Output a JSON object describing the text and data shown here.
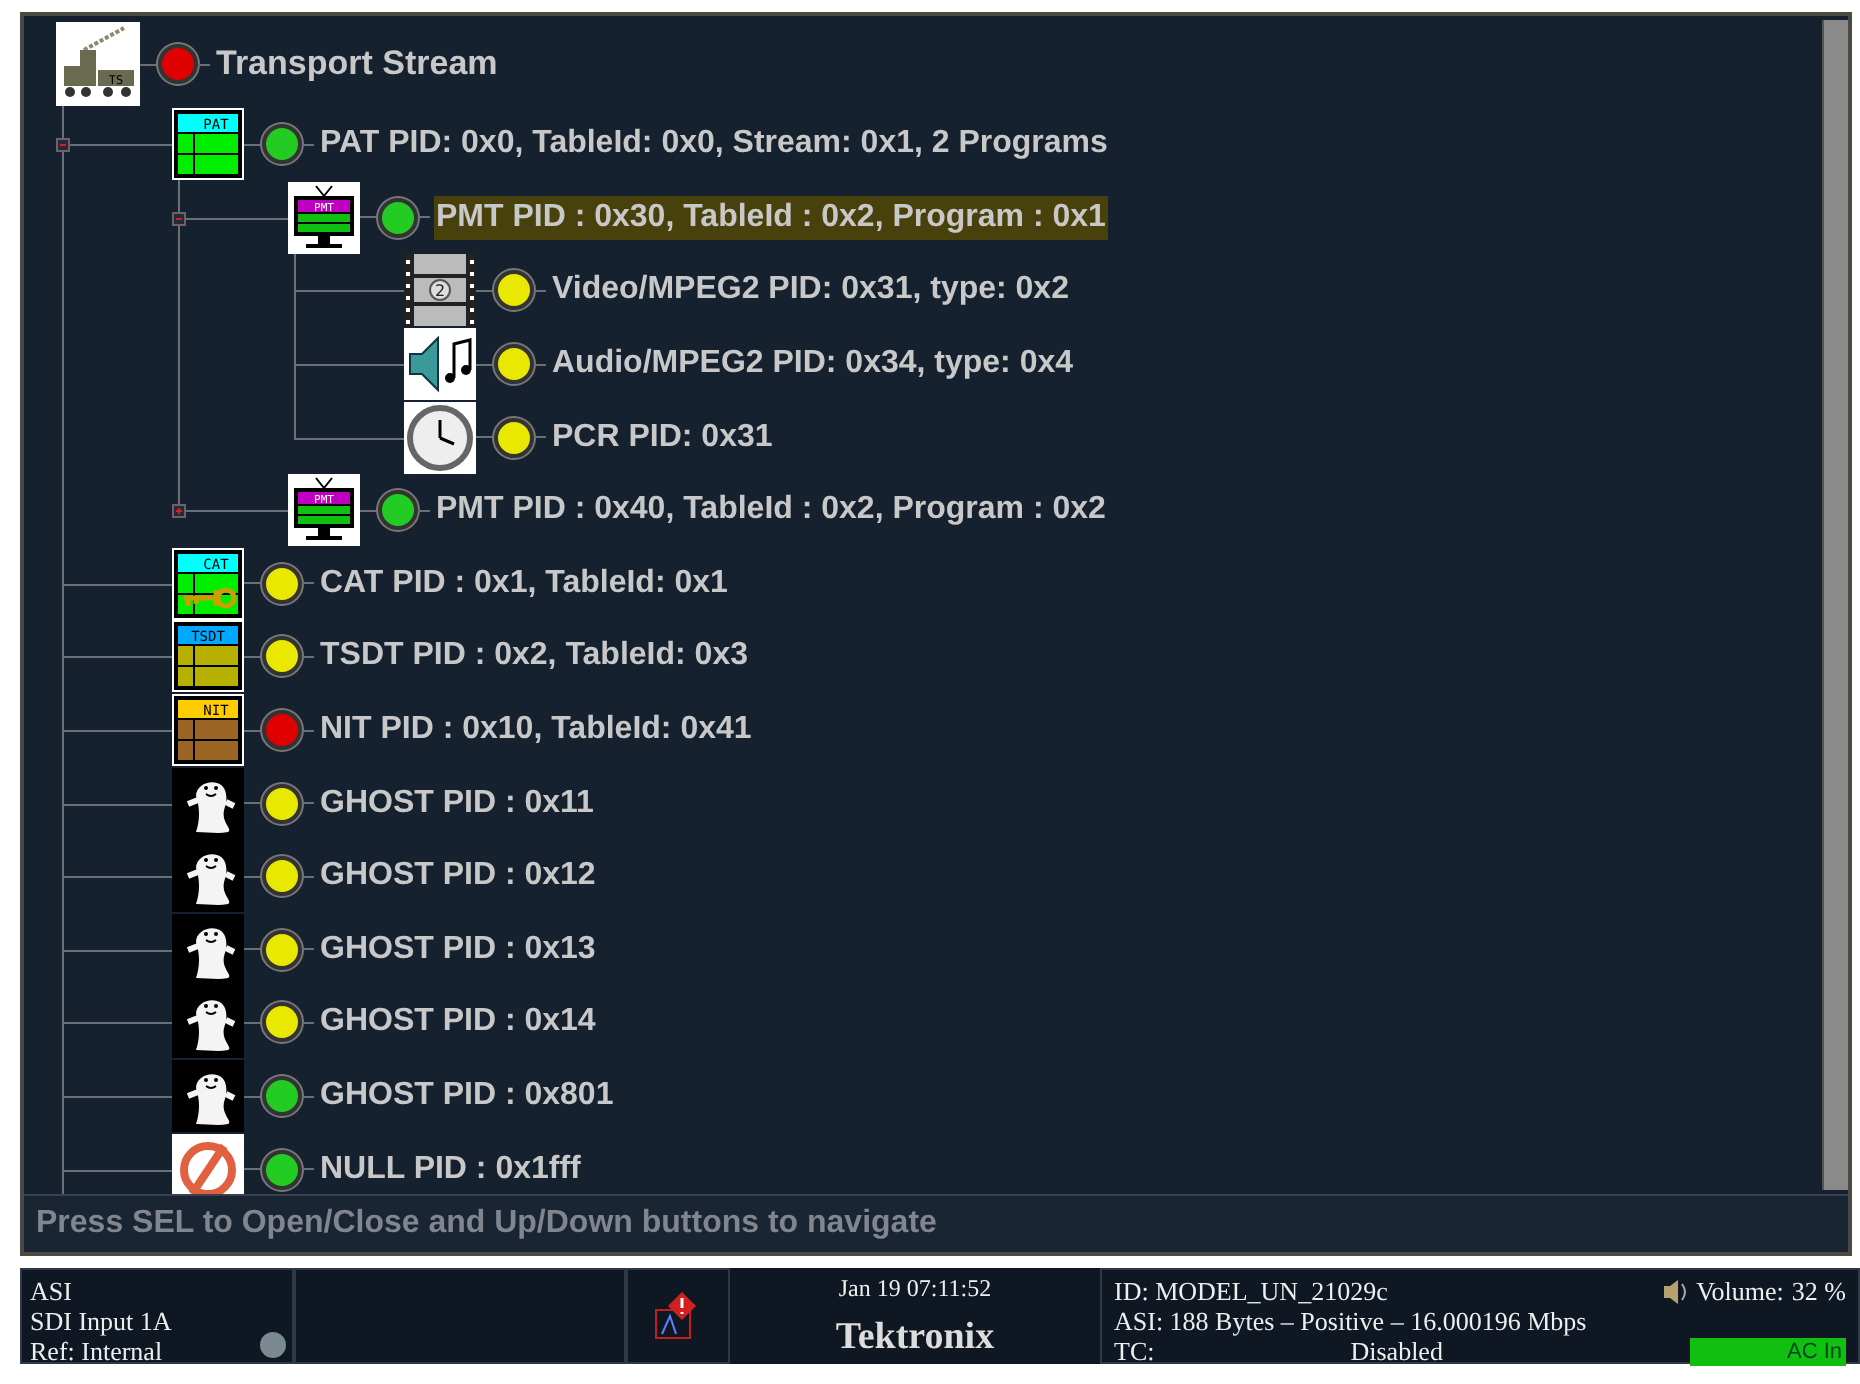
{
  "tree": {
    "root": {
      "kind": "stream",
      "icon_label": "TS",
      "label": "Transport Stream",
      "color": "#e00000",
      "selected": false,
      "children": [
        {
          "kind": "pat",
          "icon_label": "PAT",
          "label": "PAT PID: 0x0, TableId: 0x0, Stream: 0x1, 2 Programs",
          "color": "#22cc22",
          "selected": false,
          "expanded": true,
          "children": [
            {
              "kind": "pmt",
              "icon_label": "PMT",
              "label": "PMT PID : 0x30, TableId : 0x2, Program : 0x1",
              "color": "#22cc22",
              "selected": true,
              "expanded": true,
              "children": [
                {
                  "kind": "video",
                  "icon_label": "2",
                  "label": "Video/MPEG2 PID: 0x31, type: 0x2",
                  "color": "#e8e800",
                  "selected": false
                },
                {
                  "kind": "audio",
                  "label": "Audio/MPEG2 PID: 0x34, type: 0x4",
                  "color": "#e8e800",
                  "selected": false
                },
                {
                  "kind": "clock",
                  "label": "PCR PID: 0x31",
                  "color": "#e8e800",
                  "selected": false
                }
              ]
            },
            {
              "kind": "pmt",
              "icon_label": "PMT",
              "label": "PMT PID : 0x40, TableId : 0x2, Program : 0x2",
              "color": "#22cc22",
              "selected": false,
              "expanded": false
            }
          ]
        },
        {
          "kind": "cat",
          "icon_label": "CAT",
          "label": "CAT PID : 0x1, TableId: 0x1",
          "color": "#e8e800",
          "selected": false
        },
        {
          "kind": "tsdt",
          "icon_label": "TSDT",
          "label": "TSDT PID : 0x2, TableId: 0x3",
          "color": "#e8e800",
          "selected": false
        },
        {
          "kind": "nit",
          "icon_label": "NIT",
          "label": "NIT PID : 0x10, TableId: 0x41",
          "color": "#e00000",
          "selected": false
        },
        {
          "kind": "ghost",
          "label": "GHOST PID : 0x11",
          "color": "#e8e800",
          "selected": false
        },
        {
          "kind": "ghost",
          "label": "GHOST PID : 0x12",
          "color": "#e8e800",
          "selected": false
        },
        {
          "kind": "ghost",
          "label": "GHOST PID : 0x13",
          "color": "#e8e800",
          "selected": false
        },
        {
          "kind": "ghost",
          "label": "GHOST PID : 0x14",
          "color": "#e8e800",
          "selected": false
        },
        {
          "kind": "ghost",
          "label": "GHOST PID : 0x801",
          "color": "#22cc22",
          "selected": false
        },
        {
          "kind": "null",
          "label": "NULL PID : 0x1fff",
          "color": "#22cc22",
          "selected": false
        }
      ]
    }
  },
  "hint": "Press SEL to Open/Close and Up/Down buttons to navigate",
  "status_bar": {
    "input_lines": [
      "ASI",
      "SDI Input 1A",
      "Ref: Internal"
    ],
    "datetime": "Jan 19 07:11:52",
    "brand": "Tektronix",
    "info": {
      "id": "ID: MODEL_UN_21029c",
      "volume_label": "Volume:",
      "volume_value": "32 %",
      "signal": "ASI: 188 Bytes – Positive – 16.000196 Mbps",
      "tc_label": "TC:",
      "tc_value": "Disabled",
      "power": "AC In"
    }
  }
}
